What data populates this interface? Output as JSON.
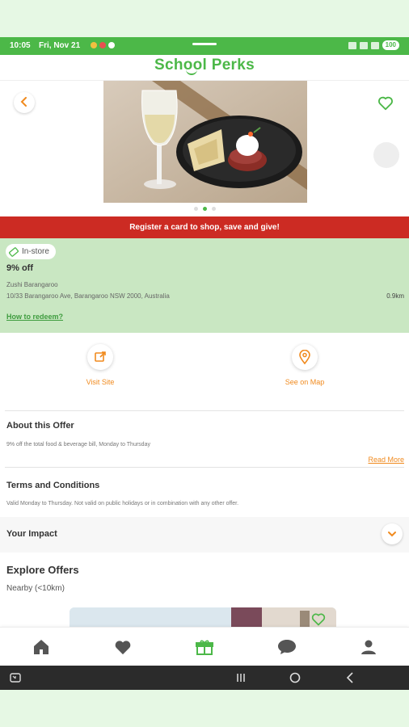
{
  "status_bar": {
    "time": "10:05",
    "date": "Fri, Nov 21",
    "battery": "100"
  },
  "header": {
    "logo_text": "School Perks"
  },
  "hero": {
    "image_description_icon": "wine-and-plated-dish-photo",
    "carousel_count": 3,
    "carousel_active": 1
  },
  "banner": {
    "text": "Register a card to shop, save and give!"
  },
  "offer": {
    "badge": "In-store",
    "percent": "9% off",
    "venue": "Zushi Barangaroo",
    "address": "10/33 Barangaroo Ave, Barangaroo NSW 2000, Australia",
    "distance": "0.9km",
    "how_to_redeem": "How to redeem?"
  },
  "actions": {
    "visit_site": "Visit Site",
    "see_on_map": "See on Map"
  },
  "about": {
    "title": "About this Offer",
    "body": "9% off the total food & beverage bill, Monday to Thursday",
    "read_more": "Read More"
  },
  "terms": {
    "title": "Terms and Conditions",
    "body": "Valid Monday to Thursday. Not valid on public holidays or in combination with any other offer."
  },
  "impact": {
    "title": "Your Impact"
  },
  "explore": {
    "title": "Explore Offers",
    "subtitle": "Nearby (<10km)"
  },
  "colors": {
    "brand_green": "#4cb848",
    "accent_orange": "#f08a1e",
    "banner_red": "#cc2b23",
    "offer_panel_bg": "#c9e7c2"
  }
}
